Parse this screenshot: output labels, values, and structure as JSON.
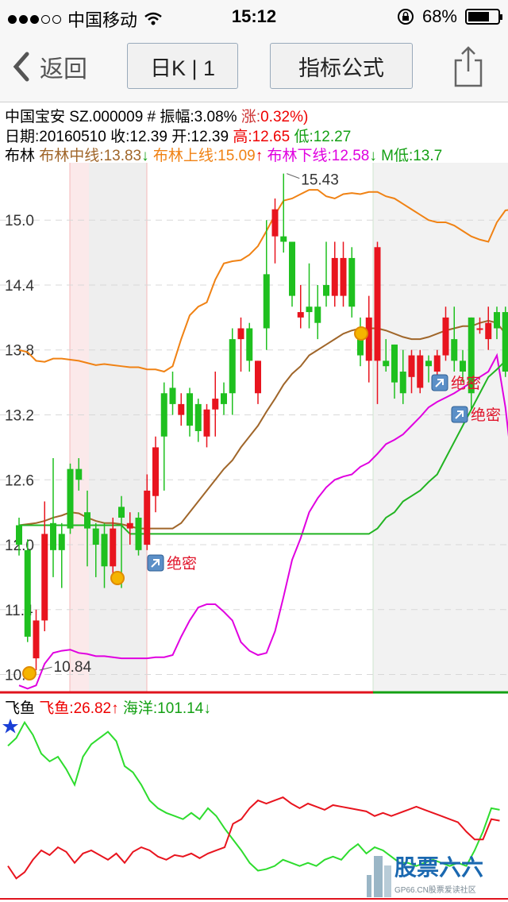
{
  "status": {
    "carrier": "中国移动",
    "time": "15:12",
    "battery": "68%"
  },
  "nav": {
    "back": "返回",
    "period": "日K | 1",
    "formula": "指标公式"
  },
  "stock": {
    "name": "中国宝安",
    "code": "SZ.000009",
    "amp_label": "# 振幅:",
    "amplitude": "3.08%",
    "chg_label": "涨:",
    "change": "0.32%)"
  },
  "quote": {
    "date": "日期:20160510",
    "close": "收:12.39",
    "open": "开:12.39",
    "high": "高:12.65",
    "low": "低:12.27"
  },
  "boll": {
    "label": "布林",
    "mid": "布林中线:13.83",
    "upper": "布林上线:15.09",
    "lower": "布林下线:12.58",
    "mlow": "M低:13.7"
  },
  "sub": {
    "label": "飞鱼",
    "fly": "飞鱼:26.82",
    "ocean": "海洋:101.14"
  },
  "watermark": {
    "text": "股票六六",
    "url": "GP66.CN股票爱读社区"
  },
  "chart_data": {
    "type": "candlestick",
    "yticks": [
      "15.0",
      "14.4",
      "13.8",
      "13.2",
      "12.6",
      "12.0",
      "11.4",
      "10.8"
    ],
    "annotations": {
      "high": "15.43",
      "low": "10.84",
      "signal": "绝密"
    },
    "candles": [
      [
        12.18,
        12.0,
        12.25,
        11.9
      ],
      [
        11.95,
        11.15,
        12.05,
        11.1
      ],
      [
        10.95,
        11.3,
        11.4,
        10.84
      ],
      [
        11.3,
        12.1,
        12.4,
        11.2
      ],
      [
        12.2,
        11.95,
        12.8,
        11.7
      ],
      [
        12.1,
        11.95,
        12.2,
        11.6
      ],
      [
        12.7,
        12.15,
        12.75,
        12.1
      ],
      [
        12.7,
        12.6,
        12.8,
        12.5
      ],
      [
        12.3,
        12.15,
        12.5,
        11.8
      ],
      [
        12.15,
        12.0,
        12.2,
        11.7
      ],
      [
        12.1,
        11.8,
        12.2,
        11.6
      ],
      [
        11.8,
        12.15,
        12.25,
        11.7
      ],
      [
        12.35,
        12.25,
        12.45,
        11.6
      ],
      [
        12.15,
        12.2,
        12.3,
        12.0
      ],
      [
        12.25,
        11.95,
        12.3,
        11.9
      ],
      [
        12.0,
        12.5,
        12.65,
        11.95
      ],
      [
        12.45,
        12.9,
        13.0,
        12.3
      ],
      [
        13.4,
        13.0,
        13.5,
        12.5
      ],
      [
        13.45,
        13.3,
        13.6,
        13.2
      ],
      [
        13.2,
        13.3,
        13.4,
        13.1
      ],
      [
        13.4,
        13.1,
        13.45,
        13.0
      ],
      [
        13.3,
        13.05,
        13.35,
        12.95
      ],
      [
        13.0,
        13.25,
        13.3,
        12.9
      ],
      [
        13.25,
        13.35,
        13.6,
        13.0
      ],
      [
        13.4,
        13.3,
        13.5,
        13.2
      ],
      [
        13.9,
        13.4,
        14.0,
        13.2
      ],
      [
        13.9,
        14.0,
        14.1,
        13.6
      ],
      [
        14.0,
        13.7,
        14.05,
        13.6
      ],
      [
        13.4,
        13.7,
        13.7,
        13.3
      ],
      [
        14.5,
        14.0,
        15.0,
        13.8
      ],
      [
        14.85,
        15.1,
        15.2,
        14.6
      ],
      [
        14.85,
        14.8,
        15.43,
        14.7
      ],
      [
        14.8,
        14.3,
        14.8,
        14.2
      ],
      [
        14.1,
        14.15,
        14.4,
        14.0
      ],
      [
        14.2,
        14.15,
        14.6,
        14.0
      ],
      [
        14.2,
        14.05,
        14.4,
        13.9
      ],
      [
        14.4,
        14.3,
        14.8,
        14.2
      ],
      [
        14.3,
        14.65,
        14.8,
        14.2
      ],
      [
        14.3,
        14.65,
        14.8,
        14.2
      ],
      [
        14.65,
        14.2,
        14.75,
        14.1
      ],
      [
        14.0,
        13.75,
        14.1,
        13.65
      ],
      [
        13.7,
        14.1,
        14.3,
        13.5
      ],
      [
        13.7,
        14.75,
        14.8,
        13.3
      ],
      [
        13.7,
        13.65,
        13.9,
        13.6
      ],
      [
        13.85,
        13.5,
        13.85,
        13.35
      ],
      [
        13.6,
        13.4,
        13.8,
        13.3
      ],
      [
        13.55,
        13.75,
        13.8,
        13.4
      ],
      [
        13.45,
        13.75,
        13.8,
        13.4
      ],
      [
        13.7,
        13.65,
        13.75,
        13.5
      ],
      [
        13.6,
        13.75,
        13.8,
        13.5
      ],
      [
        13.75,
        14.1,
        14.2,
        13.7
      ],
      [
        13.9,
        13.7,
        14.2,
        13.6
      ],
      [
        13.7,
        13.6,
        13.8,
        13.5
      ],
      [
        14.1,
        13.4,
        14.1,
        13.25
      ],
      [
        14.0,
        14.0,
        14.1,
        13.95
      ],
      [
        13.9,
        14.05,
        14.2,
        13.8
      ],
      [
        14.15,
        14.0,
        14.2,
        13.9
      ],
      [
        14.15,
        13.6,
        14.2,
        13.55
      ],
      [
        13.3,
        12.7,
        13.45,
        12.5
      ],
      [
        12.4,
        12.39,
        12.65,
        12.27
      ]
    ],
    "boll_upper": [
      13.8,
      13.78,
      13.7,
      13.69,
      13.72,
      13.72,
      13.71,
      13.7,
      13.68,
      13.66,
      13.67,
      13.66,
      13.65,
      13.64,
      13.64,
      13.62,
      13.62,
      13.6,
      13.65,
      13.9,
      14.12,
      14.2,
      14.24,
      14.45,
      14.6,
      14.62,
      14.63,
      14.68,
      14.76,
      14.9,
      15.05,
      15.18,
      15.2,
      15.24,
      15.28,
      15.28,
      15.22,
      15.2,
      15.24,
      15.25,
      15.24,
      15.26,
      15.26,
      15.22,
      15.2,
      15.15,
      15.1,
      15.05,
      15.0,
      14.98,
      14.98,
      14.95,
      14.9,
      14.85,
      14.82,
      14.8,
      14.98,
      15.09,
      15.1
    ],
    "boll_mid": [
      12.18,
      12.19,
      12.2,
      12.22,
      12.25,
      12.27,
      12.3,
      12.29,
      12.25,
      12.22,
      12.2,
      12.2,
      12.19,
      12.17,
      12.15,
      12.15,
      12.15,
      12.15,
      12.15,
      12.2,
      12.3,
      12.4,
      12.5,
      12.6,
      12.7,
      12.78,
      12.9,
      13.0,
      13.1,
      13.23,
      13.35,
      13.48,
      13.58,
      13.65,
      13.75,
      13.8,
      13.85,
      13.9,
      13.95,
      13.98,
      14.0,
      14.0,
      14.0,
      13.98,
      13.95,
      13.92,
      13.9,
      13.9,
      13.92,
      13.95,
      13.98,
      14.0,
      14.02,
      14.02,
      14.05,
      14.07,
      14.05,
      13.95,
      13.83
    ],
    "boll_lower": [
      10.7,
      10.67,
      10.7,
      10.9,
      11.0,
      11.02,
      11.03,
      11.0,
      10.99,
      10.97,
      10.97,
      10.96,
      10.95,
      10.95,
      10.95,
      10.95,
      10.96,
      10.96,
      10.98,
      11.15,
      11.3,
      11.42,
      11.45,
      11.45,
      11.38,
      11.3,
      11.1,
      11.02,
      10.98,
      11.0,
      11.2,
      11.52,
      11.86,
      12.06,
      12.3,
      12.43,
      12.53,
      12.6,
      12.63,
      12.65,
      12.72,
      12.76,
      12.84,
      12.93,
      12.97,
      13.02,
      13.1,
      13.18,
      13.27,
      13.32,
      13.36,
      13.4,
      13.45,
      13.5,
      13.55,
      13.6,
      13.75,
      13.27,
      12.58
    ],
    "m_low": [
      12.18,
      12.18,
      12.18,
      12.18,
      12.18,
      12.18,
      12.18,
      12.18,
      12.18,
      12.18,
      12.18,
      12.18,
      12.18,
      12.1,
      12.1,
      12.1,
      12.1,
      12.1,
      12.1,
      12.1,
      12.1,
      12.1,
      12.1,
      12.1,
      12.1,
      12.1,
      12.1,
      12.1,
      12.1,
      12.1,
      12.1,
      12.1,
      12.1,
      12.1,
      12.1,
      12.1,
      12.1,
      12.1,
      12.1,
      12.1,
      12.1,
      12.1,
      12.15,
      12.25,
      12.3,
      12.4,
      12.45,
      12.5,
      12.58,
      12.65,
      12.8,
      12.95,
      13.1,
      13.25,
      13.4,
      13.55,
      13.62,
      13.7,
      13.75
    ],
    "fly": [
      18,
      10,
      14,
      22,
      28,
      25,
      30,
      27,
      20,
      26,
      28,
      25,
      22,
      26,
      20,
      27,
      30,
      28,
      24,
      22,
      25,
      24,
      26,
      23,
      26,
      28,
      30,
      45,
      48,
      55,
      60,
      58,
      60,
      62,
      58,
      55,
      58,
      56,
      54,
      57,
      56,
      55,
      54,
      53,
      50,
      52,
      50,
      52,
      54,
      56,
      54,
      52,
      50,
      48,
      46,
      40,
      35,
      35,
      48,
      47
    ],
    "ocean": [
      95,
      100,
      110,
      102,
      90,
      85,
      88,
      80,
      70,
      88,
      96,
      100,
      104,
      98,
      82,
      78,
      70,
      60,
      55,
      52,
      50,
      48,
      52,
      48,
      55,
      50,
      42,
      35,
      28,
      20,
      15,
      16,
      18,
      22,
      20,
      18,
      20,
      18,
      22,
      24,
      22,
      28,
      32,
      26,
      30,
      28,
      24,
      20,
      20,
      18,
      20,
      22,
      20,
      18,
      20,
      18,
      28,
      40,
      55,
      54
    ]
  }
}
